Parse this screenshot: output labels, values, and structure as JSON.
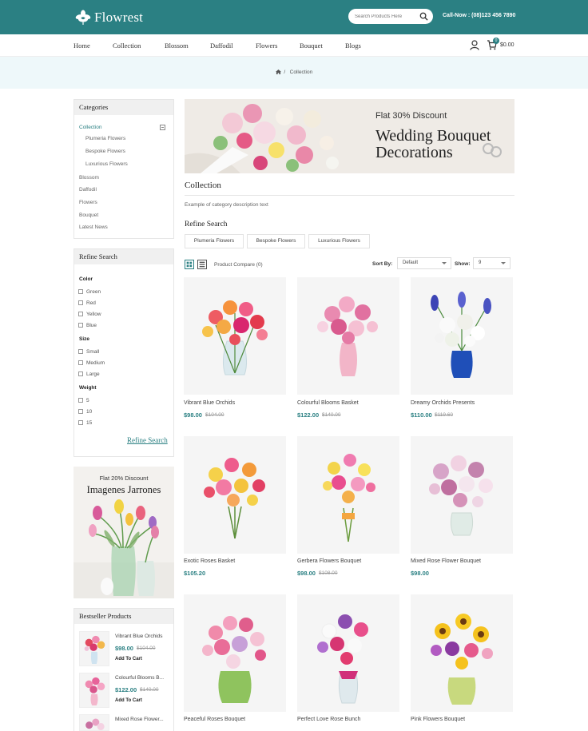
{
  "header": {
    "logo_text": "Flowrest",
    "search_placeholder": "Search Products Here",
    "call_now": "Call-Now : (08)123 456 7890",
    "brand_color": "#2b8083"
  },
  "nav": {
    "items": [
      "Home",
      "Collection",
      "Blossom",
      "Daffodil",
      "Flowers",
      "Bouquet",
      "Blogs"
    ],
    "cart_count": "0",
    "cart_total": "$0.00"
  },
  "breadcrumb": {
    "current": "Collection"
  },
  "sidebar": {
    "categories_title": "Categories",
    "categories": [
      {
        "label": "Collection"
      },
      {
        "label": "Plumeria Flowers"
      },
      {
        "label": "Bespoke Flowers"
      },
      {
        "label": "Luxurious Flowers"
      },
      {
        "label": "Blossom"
      },
      {
        "label": "Daffodil"
      },
      {
        "label": "Flowers"
      },
      {
        "label": "Bouquet"
      },
      {
        "label": "Latest News"
      }
    ],
    "refine_title": "Refine Search",
    "color_label": "Color",
    "colors": [
      "Green",
      "Red",
      "Yellow",
      "Blue"
    ],
    "size_label": "Size",
    "sizes": [
      "Small",
      "Medium",
      "Large"
    ],
    "weight_label": "Weight",
    "weights": [
      "5",
      "10",
      "15"
    ],
    "refine_link": "Refine Search",
    "promo_sub": "Flat 20% Discount",
    "promo_title": "Imagenes Jarrones",
    "bestseller_title": "Bestseller Products",
    "bestsellers": [
      {
        "name": "Vibrant Blue Orchids",
        "price": "$98.00",
        "old": "$104.00",
        "cart": "Add To Cart"
      },
      {
        "name": "Colourful Blooms B...",
        "price": "$122.00",
        "old": "$140.00",
        "cart": "Add To Cart"
      },
      {
        "name": "Mixed Rose Flower..."
      }
    ]
  },
  "banner": {
    "sub": "Flat 30% Discount",
    "title_line1": "Wedding Bouquet",
    "title_line2": "Decorations"
  },
  "main": {
    "title": "Collection",
    "description": "Example of category description text",
    "refine_title": "Refine Search",
    "refine_buttons": [
      "Plumeria Flowers",
      "Bespoke Flowers",
      "Luxurious Flowers"
    ],
    "compare": "Product Compare (0)",
    "sort_label": "Sort By:",
    "sort_value": "Default",
    "show_label": "Show:",
    "show_value": "9"
  },
  "products": [
    {
      "name": "Vibrant Blue Orchids",
      "price": "$98.00",
      "old": "$104.00"
    },
    {
      "name": "Colourful Blooms Basket",
      "price": "$122.00",
      "old": "$140.00"
    },
    {
      "name": "Dreamy Orchids Presents",
      "price": "$110.00",
      "old": "$119.60"
    },
    {
      "name": "Exotic Roses Basket",
      "price": "$105.20",
      "old": ""
    },
    {
      "name": "Gerbera Flowers Bouquet",
      "price": "$98.00",
      "old": "$108.00"
    },
    {
      "name": "Mixed Rose Flower Bouquet",
      "price": "$98.00",
      "old": ""
    },
    {
      "name": "Peaceful Roses Bouquet",
      "price": "",
      "old": ""
    },
    {
      "name": "Perfect Love Rose Bunch",
      "price": "",
      "old": ""
    },
    {
      "name": "Pink Flowers Bouquet",
      "price": "",
      "old": ""
    }
  ]
}
